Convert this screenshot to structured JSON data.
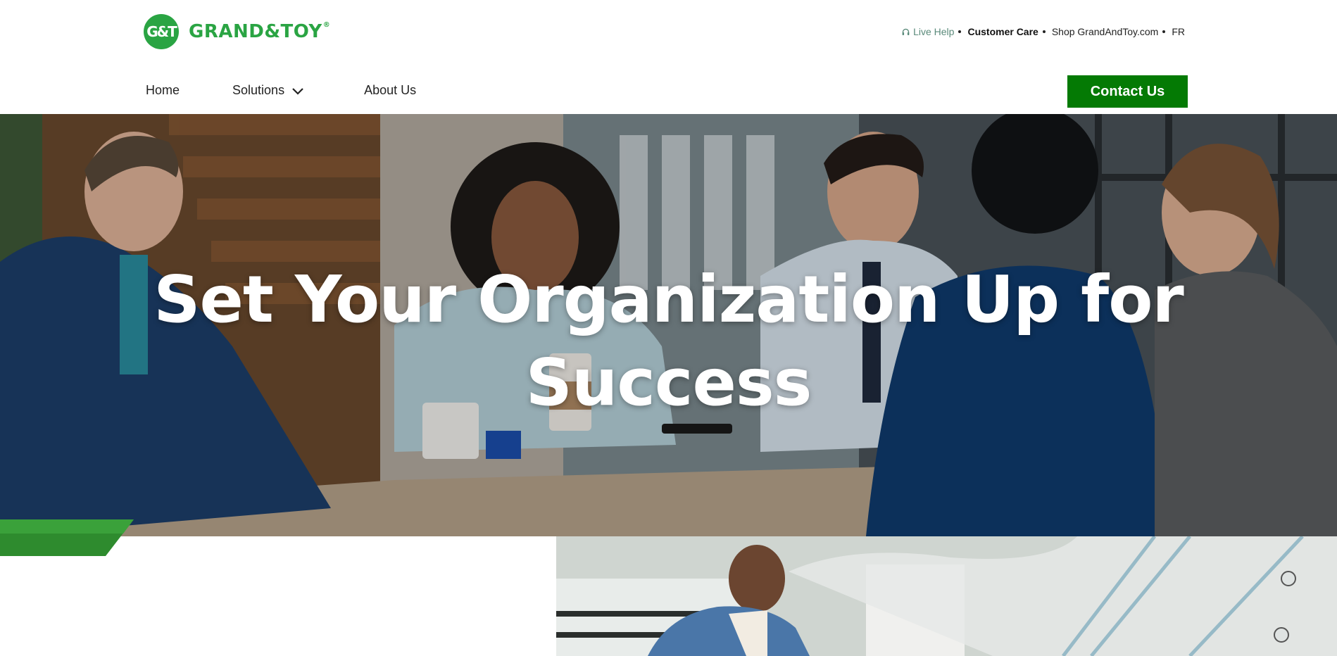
{
  "brand": {
    "badge_text": "G&T",
    "wordmark": "GRAND&TOY",
    "registered": "®",
    "color": "#2aa443"
  },
  "utility_nav": {
    "live_help": {
      "label": "Live Help",
      "icon": "headset-icon"
    },
    "customer_care": "Customer Care",
    "shop": "Shop GrandAndToy.com",
    "language": "FR"
  },
  "main_nav": {
    "items": [
      {
        "label": "Home"
      },
      {
        "label": "Solutions",
        "icon": "chevron-down-icon"
      },
      {
        "label": "About Us"
      }
    ],
    "cta": {
      "label": "Contact Us",
      "color": "#047a04"
    }
  },
  "hero": {
    "title_line1": "Set Your Organization Up for",
    "title_line2": "Success"
  },
  "colors": {
    "accent_green": "#2aa443",
    "cta_green": "#047a04"
  }
}
